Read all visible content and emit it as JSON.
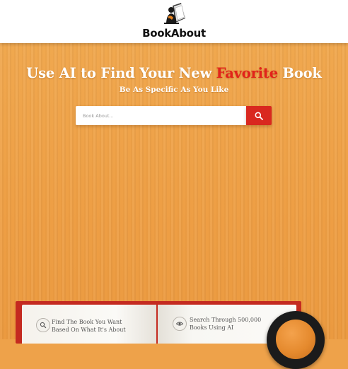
{
  "header": {
    "brand": "BookAbout",
    "logo_icon": "reader-logo-icon"
  },
  "hero": {
    "headline_before": "Use AI to Find Your New ",
    "headline_accent": "Favorite",
    "headline_after": " Book",
    "subline": "Be As Specific As You Like",
    "accent_color": "#e2231a",
    "background_color": "#eea24a"
  },
  "search": {
    "placeholder": "Book About...",
    "value": "",
    "button_icon": "search-icon",
    "button_color": "#d9281f"
  },
  "features": [
    {
      "icon": "search-icon",
      "line1": "Find The Book You Want",
      "line2": "Based On What It's About"
    },
    {
      "icon": "eye-icon",
      "line1": "Search Through 500,000",
      "line2": "Books Using AI"
    }
  ],
  "decor": {
    "book_cover_color": "#c42a20",
    "magnifier_icon": "magnifying-glass-icon"
  }
}
